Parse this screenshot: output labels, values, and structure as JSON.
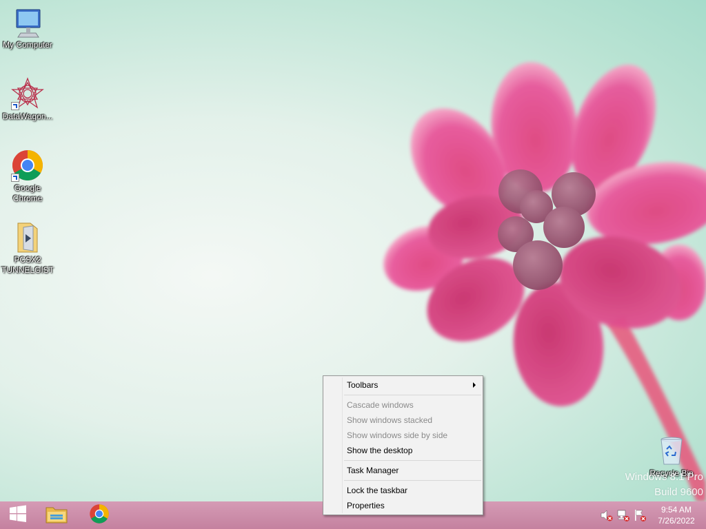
{
  "desktop": {
    "icons": [
      {
        "label": "My Computer",
        "icon": "computer-icon"
      },
      {
        "label": "DataWagon...",
        "icon": "datawagon-icon"
      },
      {
        "label": "Google\nChrome",
        "icon": "chrome-icon"
      },
      {
        "label": "PCSX2\nTUNNELGIST",
        "icon": "folder-icon"
      },
      {
        "label": "Recycle Bin",
        "icon": "recycle-bin-icon"
      }
    ],
    "watermark": {
      "line1": "Windows 8.1 Pro",
      "line2": "Build 9600"
    }
  },
  "taskbar": {
    "buttons": [
      {
        "icon": "windows-start-icon"
      },
      {
        "icon": "file-explorer-icon"
      },
      {
        "icon": "chrome-icon"
      }
    ],
    "tray": {
      "icons": [
        "volume-muted-icon",
        "network-disconnected-icon",
        "action-center-flag-icon"
      ],
      "time": "9:54 AM",
      "date": "7/26/2022"
    },
    "color": "#c98aa6"
  },
  "context_menu": {
    "items": [
      {
        "label": "Toolbars",
        "enabled": true,
        "submenu": true
      },
      {
        "label": "Cascade windows",
        "enabled": false
      },
      {
        "label": "Show windows stacked",
        "enabled": false
      },
      {
        "label": "Show windows side by side",
        "enabled": false
      },
      {
        "label": "Show the desktop",
        "enabled": true
      },
      {
        "label": "Task Manager",
        "enabled": true
      },
      {
        "label": "Lock the taskbar",
        "enabled": true
      },
      {
        "label": "Properties",
        "enabled": true
      }
    ]
  }
}
